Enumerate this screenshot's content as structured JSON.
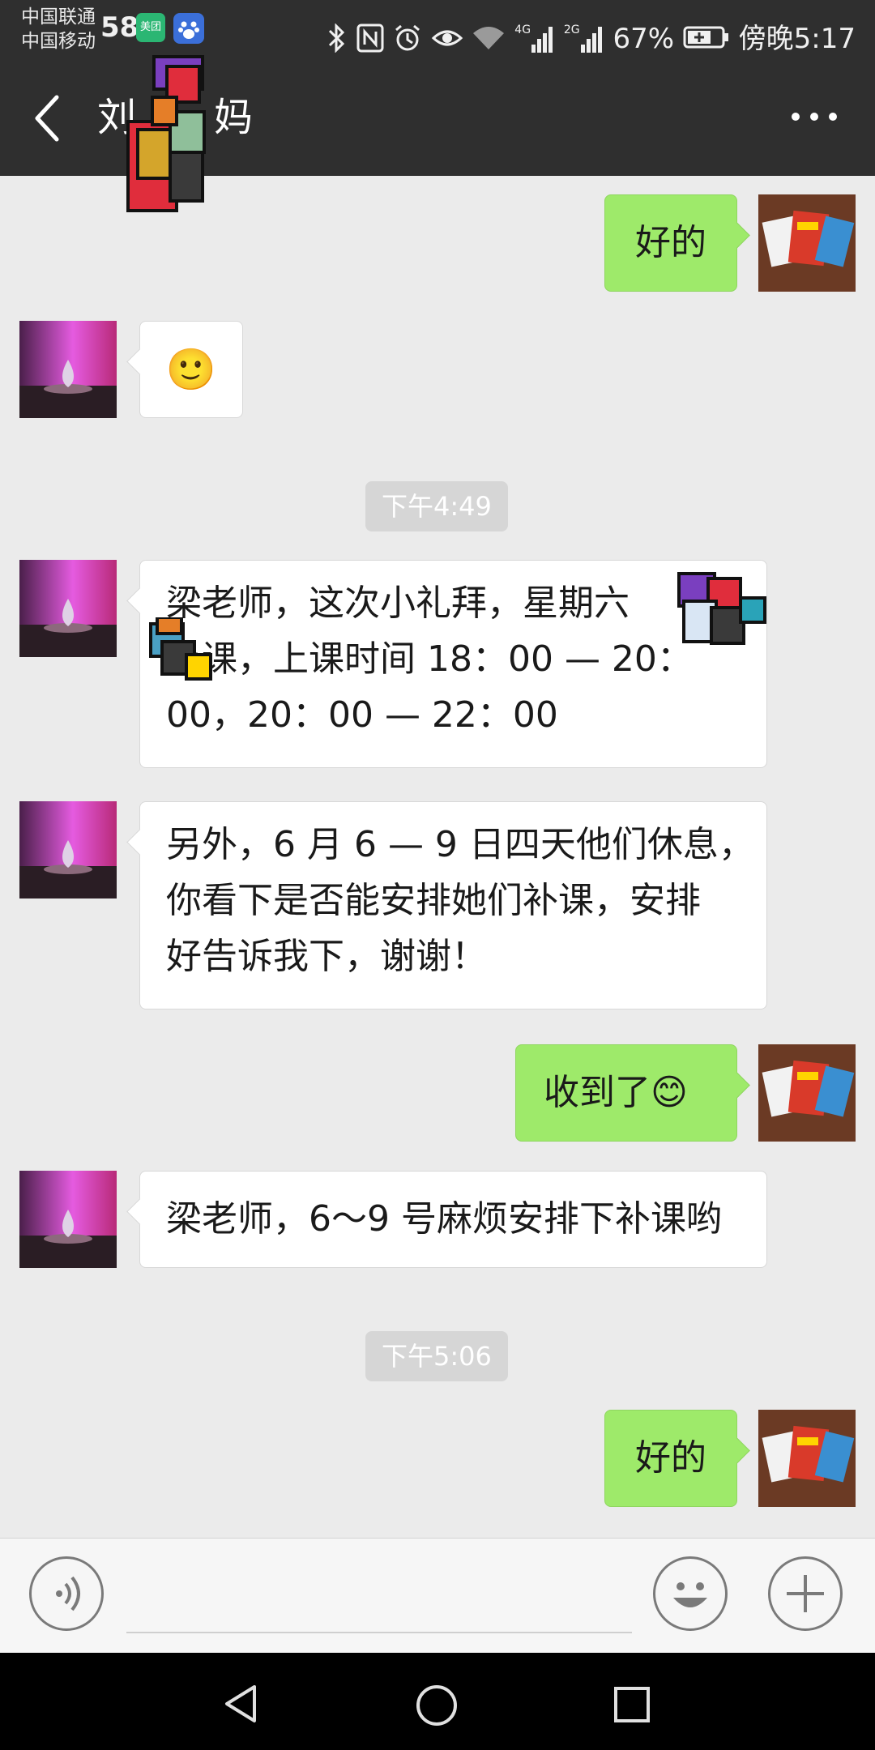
{
  "status_bar": {
    "carrier_1": "中国联通",
    "carrier_2": "中国移动",
    "app_icons": [
      "58",
      "美团",
      "baidu-paw-icon"
    ],
    "signal_4g": "4G",
    "signal_2g": "2G",
    "battery": "67%",
    "time": "傍晚5:17"
  },
  "header": {
    "title": "刘",
    "title_suffix": "妈",
    "back_icon": "chevron-left-icon",
    "more_icon": "more-dots-icon"
  },
  "messages": [
    {
      "side": "out",
      "text": "好的"
    },
    {
      "side": "in",
      "type": "emoji",
      "emoji": "🙂"
    },
    {
      "type": "time",
      "text": "下午4:49"
    },
    {
      "side": "in",
      "lines": [
        "梁老师，这次小礼拜，星期六",
        "上课，上课时间 18：00 — 20：",
        "00，20：00 — 22：00"
      ]
    },
    {
      "side": "in",
      "lines": [
        "另外，6 月 6 — 9 日四天他们休息，",
        "你看下是否能安排她们补课，安排",
        "好告诉我下，谢谢！"
      ]
    },
    {
      "side": "out",
      "text": "收到了",
      "emoji": "😊"
    },
    {
      "side": "in",
      "text": "梁老师，6～9 号麻烦安排下补课哟"
    },
    {
      "type": "time",
      "text": "下午5:06"
    },
    {
      "side": "out",
      "text": "好的"
    }
  ],
  "input_bar": {
    "voice_icon": "voice-icon",
    "emoji_icon": "emoji-icon",
    "plus_icon": "plus-icon"
  },
  "colors": {
    "bar": "#2f2f2f",
    "background": "#ebebeb",
    "outgoing_bubble": "#9eea6a",
    "incoming_bubble": "#ffffff",
    "timestamp_bg": "#d6d6d6"
  }
}
